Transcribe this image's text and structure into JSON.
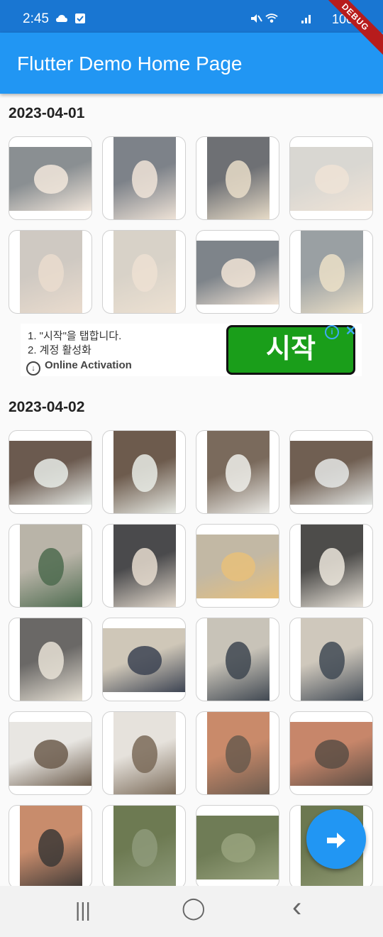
{
  "status_bar": {
    "time": "2:45",
    "battery": "100%"
  },
  "app_bar": {
    "title": "Flutter Demo Home Page",
    "debug_banner": "DEBUG"
  },
  "sections": [
    {
      "date": "2023-04-01",
      "photos": [
        {
          "bg": "#8a8f92",
          "subject": "#f2e7dc"
        },
        {
          "bg": "#7d8289",
          "subject": "#f0e4d8"
        },
        {
          "bg": "#6e7074",
          "subject": "#e9ddc9"
        },
        {
          "bg": "#d9d7d2",
          "subject": "#efe3d6"
        },
        {
          "bg": "#cfc9c2",
          "subject": "#eadcce"
        },
        {
          "bg": "#d8d2c8",
          "subject": "#ede1d2"
        },
        {
          "bg": "#7e848a",
          "subject": "#f1e4d6"
        },
        {
          "bg": "#9aa0a3",
          "subject": "#ece0c8"
        }
      ]
    },
    {
      "date": "2023-04-02",
      "photos": [
        {
          "bg": "#6b5a4f",
          "subject": "#e8ece8"
        },
        {
          "bg": "#6d5b4d",
          "subject": "#e9ece6"
        },
        {
          "bg": "#7a6a5c",
          "subject": "#eeeeea"
        },
        {
          "bg": "#705f52",
          "subject": "#e5e8e6"
        },
        {
          "bg": "#b9b4a8",
          "subject": "#4d6b4f"
        },
        {
          "bg": "#4a4a4c",
          "subject": "#e6dccf"
        },
        {
          "bg": "#c2b8a4",
          "subject": "#e8c07a"
        },
        {
          "bg": "#4d4c4a",
          "subject": "#ece6dc"
        },
        {
          "bg": "#6a6866",
          "subject": "#e8e2d6"
        },
        {
          "bg": "#cfc7b8",
          "subject": "#3c4352"
        },
        {
          "bg": "#c8c3b8",
          "subject": "#3e4650"
        },
        {
          "bg": "#cfc8bc",
          "subject": "#414a55"
        },
        {
          "bg": "#e8e6e2",
          "subject": "#6c5c4c"
        },
        {
          "bg": "#e6e2dc",
          "subject": "#7a6a58"
        },
        {
          "bg": "#c98a6a",
          "subject": "#6a5a4e"
        },
        {
          "bg": "#c7866a",
          "subject": "#5b4d44"
        },
        {
          "bg": "#c88c6c",
          "subject": "#3c3836"
        },
        {
          "bg": "#6d7a52",
          "subject": "#8e9a7a"
        },
        {
          "bg": "#6f7c56",
          "subject": "#99a37e"
        },
        {
          "bg": "#6c7850",
          "subject": "#8e9872"
        }
      ]
    }
  ],
  "ad": {
    "line1": "1. \"시작\"을 탭합니다.",
    "line2": "2. 계정 활성화",
    "brand": "Online Activation",
    "cta": "시작"
  },
  "fab": {
    "icon": "arrow-right-icon"
  },
  "nav_bar": {
    "recent": "|||",
    "home": "◯",
    "back": "‹"
  },
  "colors": {
    "primary": "#2196f3",
    "status_bar": "#1976d2"
  }
}
